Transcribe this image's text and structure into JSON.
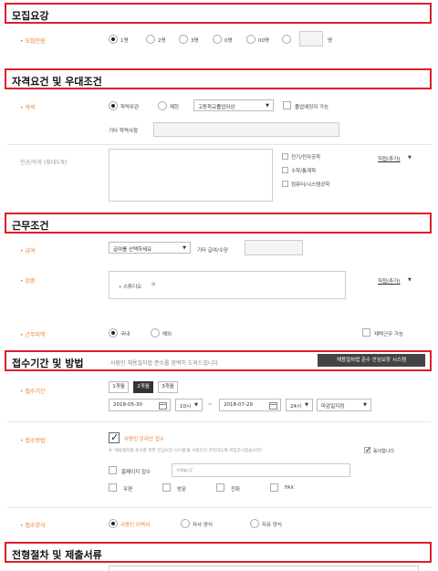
{
  "sections": {
    "recruit": "모집요강",
    "qualify": "자격요건 및 우대조건",
    "work": "근무조건",
    "apply": "접수기간 및 방법",
    "apply_note": "사람인 채용절차법 준수를 완벽히 도와드립니다.",
    "apply_btn": "채용절차법 준수 안심보장 시스템",
    "process": "전형절차 및 제출서류"
  },
  "recruit": {
    "label": "• 모집인원",
    "options": [
      "1명",
      "2명",
      "3명",
      "0명",
      "00명"
    ],
    "selected": 0,
    "unit": "명"
  },
  "edu": {
    "label": "• 학력",
    "options": [
      "학력무관",
      "제한"
    ],
    "selected": 0,
    "select_value": "고등학교졸업이상",
    "expected_grad": "졸업예정자 가능",
    "other_label": "기타 학력사항"
  },
  "major": {
    "label": "전공/학과 (최대5개)",
    "checks": [
      "전기/전자공학",
      "수학/통계학",
      "컴퓨터/시스템공학"
    ],
    "direct": "직접(추가)"
  },
  "salary": {
    "label": "• 급여",
    "select_value": "급여를 선택하세요",
    "other_label": "기타 급여/수당"
  },
  "industry": {
    "label": "• 업종",
    "tag": "• 스튜디오",
    "direct": "직접(추가)"
  },
  "region": {
    "label": "• 근무지역",
    "options": [
      "국내",
      "해외"
    ],
    "selected": 0,
    "remote": "재택근무 가능"
  },
  "period": {
    "label": "• 접수기간",
    "tabs": [
      "1개월",
      "2개월",
      "3개월"
    ],
    "active_tab": 1,
    "start_date": "2018-05-30",
    "start_time": "10시",
    "dash": "~",
    "end_date": "2018-07-29",
    "end_time": "24시",
    "deadline": "마감일지정"
  },
  "method": {
    "label": "• 접수방법",
    "online": "사람인 온라인 접수",
    "notice": "※ '채용절차법 준수를 위한 안심보장 시스템'을 사람인이 관리하도록 위임하시겠습니까?",
    "agree": "동의합니다",
    "homepage": "홈페이지 접수",
    "homepage_value": "http://",
    "others": [
      "우편",
      "방문",
      "전화",
      "FAX"
    ]
  },
  "form": {
    "label": "• 접수양식",
    "options": [
      "사람인 이력서",
      "자사 양식",
      "자유 양식"
    ],
    "selected": 0
  }
}
